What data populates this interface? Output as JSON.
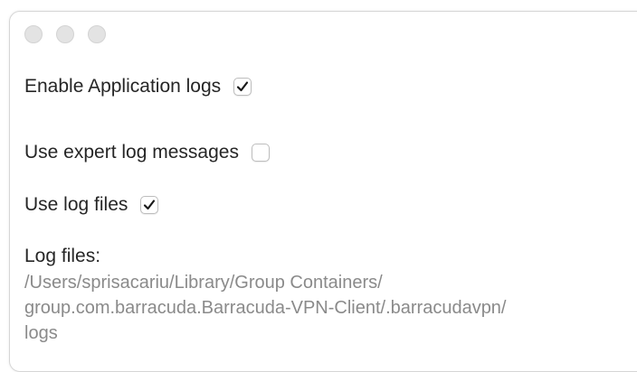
{
  "window": {
    "controls": [
      "close",
      "minimize",
      "zoom"
    ]
  },
  "settings": {
    "enable_app_logs": {
      "label": "Enable Application logs",
      "checked": true
    },
    "expert_log_messages": {
      "label": "Use expert log messages",
      "checked": false
    },
    "use_log_files": {
      "label": "Use log files",
      "checked": true
    }
  },
  "log_files": {
    "label": "Log files:",
    "path_line1": "/Users/sprisacariu/Library/Group Containers/",
    "path_line2": "group.com.barracuda.Barracuda-VPN-Client/.barracudavpn/",
    "path_line3": "logs"
  },
  "colors": {
    "text": "#262626",
    "path_text": "#8a8a8a",
    "control_gray": "#e3e3e3"
  },
  "icons": {
    "check": "checkmark-icon"
  }
}
